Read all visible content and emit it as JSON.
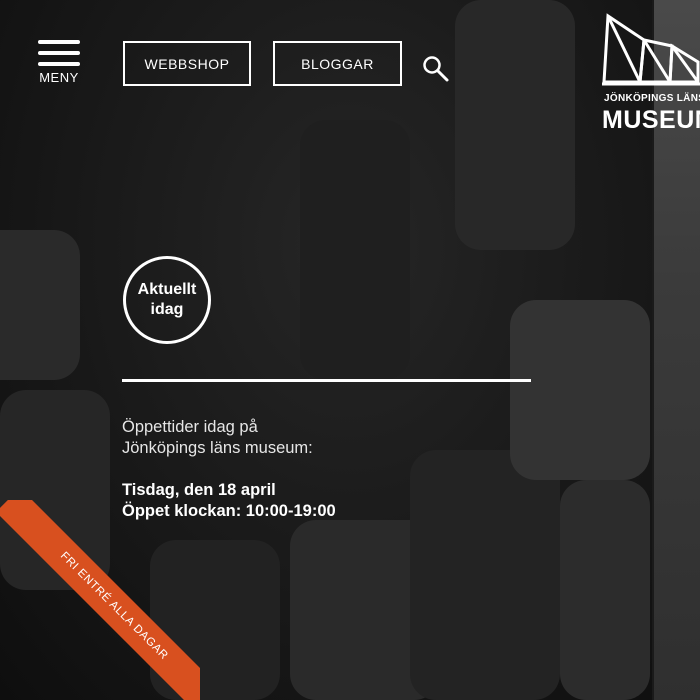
{
  "header": {
    "menu_label": "MENY",
    "webbshop_label": "WEBBSHOP",
    "bloggar_label": "BLOGGAR"
  },
  "logo": {
    "tagline": "JÖNKÖPINGS LÄNS",
    "name": "MUSEUM"
  },
  "main": {
    "badge_line1": "Aktuellt",
    "badge_line2": "idag",
    "hours_intro_line1": "Öppettider idag på",
    "hours_intro_line2": "Jönköpings läns museum:",
    "date_line": "Tisdag, den 18 april",
    "hours_line": "Öppet klockan: 10:00-19:00"
  },
  "ribbon": {
    "text": "FRI ENTRÉ ALLA DAGAR",
    "color": "#d8501f"
  }
}
